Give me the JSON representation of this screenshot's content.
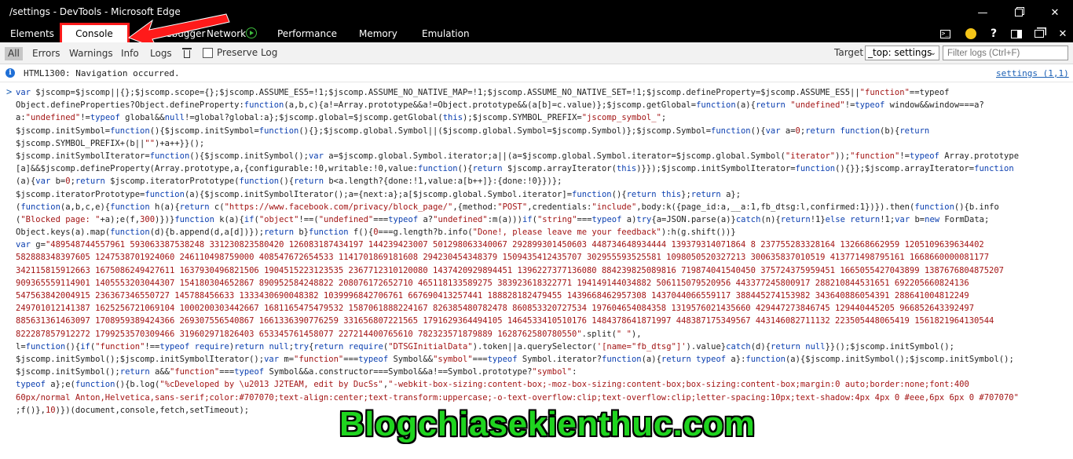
{
  "window": {
    "title": "/settings - DevTools - Microsoft Edge",
    "minimize": "—",
    "close": "✕"
  },
  "tabs": {
    "elements": "Elements",
    "console": "Console",
    "debugger": "Debugger",
    "network": "Network",
    "performance": "Performance",
    "memory": "Memory",
    "emulation": "Emulation"
  },
  "toolbar_icons": {
    "help": "?",
    "close": "✕"
  },
  "filters": {
    "all": "All",
    "errors": "Errors",
    "warnings": "Warnings",
    "info": "Info",
    "logs": "Logs",
    "preserve_log": "Preserve Log",
    "target_label": "Target",
    "target_value": "_top: settings",
    "filter_placeholder": "Filter logs (Ctrl+F)"
  },
  "console": {
    "info_message": "HTML1300: Navigation occurred.",
    "source_link": "settings (1,1)",
    "prompt": ">",
    "code_lines": [
      [
        [
          "k",
          "var "
        ],
        [
          "t",
          "$jscomp=$jscomp||{};$jscomp.scope={};$jscomp.ASSUME_ES5=!1;$jscomp.ASSUME_NO_NATIVE_MAP=!1;$jscomp.ASSUME_NO_NATIVE_SET=!1;$jscomp.defineProperty=$jscomp.ASSUME_ES5||"
        ],
        [
          "s",
          "\"function\""
        ],
        [
          "t",
          "==typeof"
        ]
      ],
      [
        [
          "t",
          "Object.defineProperties?Object.defineProperty:"
        ],
        [
          "k",
          "function"
        ],
        [
          "t",
          "(a,b,c){a!=Array.prototype&&a!=Object.prototype&&(a[b]=c.value)};$jscomp.getGlobal="
        ],
        [
          "k",
          "function"
        ],
        [
          "t",
          "(a){"
        ],
        [
          "k",
          "return "
        ],
        [
          "s",
          "\"undefined\""
        ],
        [
          "t",
          "!="
        ],
        [
          "k",
          "typeof "
        ],
        [
          "t",
          "window&&window===a?"
        ]
      ],
      [
        [
          "t",
          "a:"
        ],
        [
          "s",
          "\"undefined\""
        ],
        [
          "t",
          "!="
        ],
        [
          "k",
          "typeof "
        ],
        [
          "t",
          "global&&"
        ],
        [
          "k",
          "null"
        ],
        [
          "t",
          "!=global?global:a};$jscomp.global=$jscomp.getGlobal("
        ],
        [
          "k",
          "this"
        ],
        [
          "t",
          ");$jscomp.SYMBOL_PREFIX="
        ],
        [
          "s",
          "\"jscomp_symbol_\""
        ],
        [
          "t",
          ";"
        ]
      ],
      [
        [
          "t",
          "$jscomp.initSymbol="
        ],
        [
          "k",
          "function"
        ],
        [
          "t",
          "(){$jscomp.initSymbol="
        ],
        [
          "k",
          "function"
        ],
        [
          "t",
          "(){};$jscomp.global.Symbol||($jscomp.global.Symbol=$jscomp.Symbol)};$jscomp.Symbol="
        ],
        [
          "k",
          "function"
        ],
        [
          "t",
          "(){"
        ],
        [
          "k",
          "var "
        ],
        [
          "t",
          "a="
        ],
        [
          "n",
          "0"
        ],
        [
          "t",
          ";"
        ],
        [
          "k",
          "return function"
        ],
        [
          "t",
          "(b){"
        ],
        [
          "k",
          "return"
        ]
      ],
      [
        [
          "t",
          "$jscomp.SYMBOL_PREFIX+(b||"
        ],
        [
          "s",
          "\"\""
        ],
        [
          "t",
          ")+a++}}();"
        ]
      ],
      [
        [
          "t",
          "$jscomp.initSymbolIterator="
        ],
        [
          "k",
          "function"
        ],
        [
          "t",
          "(){$jscomp.initSymbol();"
        ],
        [
          "k",
          "var "
        ],
        [
          "t",
          "a=$jscomp.global.Symbol.iterator;a||(a=$jscomp.global.Symbol.iterator=$jscomp.global.Symbol("
        ],
        [
          "s",
          "\"iterator\""
        ],
        [
          "t",
          "));"
        ],
        [
          "s",
          "\"function\""
        ],
        [
          "t",
          "!="
        ],
        [
          "k",
          "typeof "
        ],
        [
          "t",
          "Array.prototype"
        ]
      ],
      [
        [
          "t",
          "[a]&&$jscomp.defineProperty(Array.prototype,a,{configurable:!0,writable:!0,value:"
        ],
        [
          "k",
          "function"
        ],
        [
          "t",
          "(){"
        ],
        [
          "k",
          "return "
        ],
        [
          "t",
          "$jscomp.arrayIterator("
        ],
        [
          "k",
          "this"
        ],
        [
          "t",
          ")}});$jscomp.initSymbolIterator="
        ],
        [
          "k",
          "function"
        ],
        [
          "t",
          "(){}};$jscomp.arrayIterator="
        ],
        [
          "k",
          "function"
        ]
      ],
      [
        [
          "t",
          "(a){"
        ],
        [
          "k",
          "var "
        ],
        [
          "t",
          "b="
        ],
        [
          "n",
          "0"
        ],
        [
          "t",
          ";"
        ],
        [
          "k",
          "return "
        ],
        [
          "t",
          "$jscomp.iteratorPrototype("
        ],
        [
          "k",
          "function"
        ],
        [
          "t",
          "(){"
        ],
        [
          "k",
          "return "
        ],
        [
          "t",
          "b<a.length?{done:!1,value:a[b++]}:{done:!0}})};"
        ]
      ],
      [
        [
          "t",
          "$jscomp.iteratorPrototype="
        ],
        [
          "k",
          "function"
        ],
        [
          "t",
          "(a){$jscomp.initSymbolIterator();a={next:a};a[$jscomp.global.Symbol.iterator]="
        ],
        [
          "k",
          "function"
        ],
        [
          "t",
          "(){"
        ],
        [
          "k",
          "return this"
        ],
        [
          "t",
          "};"
        ],
        [
          "k",
          "return "
        ],
        [
          "t",
          "a};"
        ]
      ],
      [
        [
          "t",
          "("
        ],
        [
          "k",
          "function"
        ],
        [
          "t",
          "(a,b,c,e){"
        ],
        [
          "k",
          "function "
        ],
        [
          "t",
          "h(a){"
        ],
        [
          "k",
          "return "
        ],
        [
          "t",
          "c("
        ],
        [
          "s",
          "\"https://www.facebook.com/privacy/block_page/\""
        ],
        [
          "t",
          ",{method:"
        ],
        [
          "s",
          "\"POST\""
        ],
        [
          "t",
          ",credentials:"
        ],
        [
          "s",
          "\"include\""
        ],
        [
          "t",
          ",body:k({page_id:a,__a:1,fb_dtsg:l,confirmed:1})}).then("
        ],
        [
          "k",
          "function"
        ],
        [
          "t",
          "(){b.info"
        ]
      ],
      [
        [
          "t",
          "("
        ],
        [
          "s",
          "\"Blocked page: \""
        ],
        [
          "t",
          "+a);e(f,"
        ],
        [
          "n",
          "300"
        ],
        [
          "t",
          ")})}"
        ],
        [
          "k",
          "function "
        ],
        [
          "t",
          "k(a){"
        ],
        [
          "k",
          "if"
        ],
        [
          "t",
          "("
        ],
        [
          "s",
          "\"object\""
        ],
        [
          "t",
          "!==("
        ],
        [
          "s",
          "\"undefined\""
        ],
        [
          "t",
          "==="
        ],
        [
          "k",
          "typeof "
        ],
        [
          "t",
          "a?"
        ],
        [
          "s",
          "\"undefined\""
        ],
        [
          "t",
          ":m(a)))"
        ],
        [
          "k",
          "if"
        ],
        [
          "t",
          "("
        ],
        [
          "s",
          "\"string\""
        ],
        [
          "t",
          "==="
        ],
        [
          "k",
          "typeof "
        ],
        [
          "t",
          "a)"
        ],
        [
          "k",
          "try"
        ],
        [
          "t",
          "{a=JSON.parse(a)}"
        ],
        [
          "k",
          "catch"
        ],
        [
          "t",
          "(n){"
        ],
        [
          "k",
          "return"
        ],
        [
          "t",
          "!1}"
        ],
        [
          "k",
          "else return"
        ],
        [
          "t",
          "!1;"
        ],
        [
          "k",
          "var "
        ],
        [
          "t",
          "b="
        ],
        [
          "k",
          "new "
        ],
        [
          "t",
          "FormData;"
        ]
      ],
      [
        [
          "t",
          "Object.keys(a).map("
        ],
        [
          "k",
          "function"
        ],
        [
          "t",
          "(d){b.append(d,a[d])});"
        ],
        [
          "k",
          "return "
        ],
        [
          "t",
          "b}"
        ],
        [
          "k",
          "function "
        ],
        [
          "t",
          "f(){"
        ],
        [
          "n",
          "0"
        ],
        [
          "t",
          "===g.length?b.info("
        ],
        [
          "s",
          "\"Done!, please leave me your feedback\""
        ],
        [
          "t",
          "):h(g.shift())}"
        ]
      ],
      [
        [
          "k",
          "var "
        ],
        [
          "t",
          "g="
        ],
        [
          "s",
          "\"489548744557961 593063387538248 331230823580420 126083187434197 144239423007 501298063340067 292899301450603 448734648934444 139379314071864 8 237755283328164 132668662959 1205109639634402"
        ]
      ],
      [
        [
          "s",
          "582888348397605 1247538701924060 246110498759000 408547672654533 1141701869181608 294230454348379 1509435412435707 302955593525581 1098050520327213 300635837010519 413771498795161 1668660000081177"
        ]
      ],
      [
        [
          "s",
          "342115815912663 1675086249427611 1637930496821506 1904515223123535 2367712310120080 1437420929894451 1396227377136080 884239825089816 719874041540450 375724375959451 1665055427043899 1387676804875207"
        ]
      ],
      [
        [
          "s",
          "909365559114901 1405553203044307 154180304652867 890952584248822 208076172652710 465118133589275 383923618322771 194149144034882 506115079520956 443377245800917 288210844531651 692205660824136"
        ]
      ],
      [
        [
          "s",
          "547563842004915 236367346550727 145788456633 1333430690048382 1039996842706761 667690413257441 188828182479455 1439668462957308 1437044066559117 388445274153982 343640886054391 288641004812249"
        ]
      ],
      [
        [
          "s",
          "249701012141387 1625256721069104 1000200303442667 1681165475479532 1587061888224167 826385480782478 860853320727534 197604654084358 1319576021435660 429447273846745 129440445205 966852643392497"
        ]
      ],
      [
        [
          "s",
          "885631361463097 1708959389424366 269307556540867 1661336390776259 331656807221565 1791629364494105 1464533410510176 1484378641871997 448387175349567 443146082711132 223505448065419 1561821964130544"
        ]
      ],
      [
        [
          "s",
          "822287857912272 1799253570309466 319602971826403 653345761458077 227214400765610 782323571879889 1628762580780550\""
        ],
        [
          "t",
          ".split("
        ],
        [
          "s",
          "\" \""
        ],
        [
          "t",
          "),"
        ]
      ],
      [
        [
          "t",
          "l="
        ],
        [
          "k",
          "function"
        ],
        [
          "t",
          "(){"
        ],
        [
          "k",
          "if"
        ],
        [
          "t",
          "("
        ],
        [
          "s",
          "\"function\""
        ],
        [
          "t",
          "!=="
        ],
        [
          "k",
          "typeof require"
        ],
        [
          "t",
          ")"
        ],
        [
          "k",
          "return null"
        ],
        [
          "t",
          ";"
        ],
        [
          "k",
          "try"
        ],
        [
          "t",
          "{"
        ],
        [
          "k",
          "return require"
        ],
        [
          "t",
          "("
        ],
        [
          "s",
          "\"DTSGInitialData\""
        ],
        [
          "t",
          ").token||a.querySelector("
        ],
        [
          "s",
          "'[name=\"fb_dtsg\"]'"
        ],
        [
          "t",
          ").value}"
        ],
        [
          "k",
          "catch"
        ],
        [
          "t",
          "(d){"
        ],
        [
          "k",
          "return null"
        ],
        [
          "t",
          "}}();$jscomp.initSymbol();"
        ]
      ],
      [
        [
          "t",
          "$jscomp.initSymbol();$jscomp.initSymbolIterator();"
        ],
        [
          "k",
          "var "
        ],
        [
          "t",
          "m="
        ],
        [
          "s",
          "\"function\""
        ],
        [
          "t",
          "==="
        ],
        [
          "k",
          "typeof "
        ],
        [
          "t",
          "Symbol&&"
        ],
        [
          "s",
          "\"symbol\""
        ],
        [
          "t",
          "==="
        ],
        [
          "k",
          "typeof "
        ],
        [
          "t",
          "Symbol.iterator?"
        ],
        [
          "k",
          "function"
        ],
        [
          "t",
          "(a){"
        ],
        [
          "k",
          "return typeof "
        ],
        [
          "t",
          "a}:"
        ],
        [
          "k",
          "function"
        ],
        [
          "t",
          "(a){$jscomp.initSymbol();$jscomp.initSymbol();"
        ]
      ],
      [
        [
          "t",
          "$jscomp.initSymbol();"
        ],
        [
          "k",
          "return "
        ],
        [
          "t",
          "a&&"
        ],
        [
          "s",
          "\"function\""
        ],
        [
          "t",
          "==="
        ],
        [
          "k",
          "typeof "
        ],
        [
          "t",
          "Symbol&&a.constructor===Symbol&&a!==Symbol.prototype?"
        ],
        [
          "s",
          "\"symbol\""
        ],
        [
          "t",
          ":"
        ]
      ],
      [
        [
          "k",
          "typeof "
        ],
        [
          "t",
          "a};e("
        ],
        [
          "k",
          "function"
        ],
        [
          "t",
          "(){b.log("
        ],
        [
          "s",
          "\"%cDeveloped by \\u2013 J2TEAM, edit by DucSs\""
        ],
        [
          "t",
          ","
        ],
        [
          "s",
          "\"-webkit-box-sizing:content-box;-moz-box-sizing:content-box;box-sizing:content-box;margin:0 auto;border:none;font:400"
        ]
      ],
      [
        [
          "s",
          "60px/normal Anton,Helvetica,sans-serif;color:#707070;text-align:center;text-transform:uppercase;-o-text-overflow:clip;text-overflow:clip;letter-spacing:10px;text-shadow:4px 4px 0 #eee,6px 6px 0 #707070\""
        ]
      ],
      [
        [
          "t",
          ";f()},"
        ],
        [
          "n",
          "10"
        ],
        [
          "t",
          ")})(document,console,fetch,setTimeout);"
        ]
      ]
    ]
  },
  "watermark": "Blogchiasekienthuc.com"
}
